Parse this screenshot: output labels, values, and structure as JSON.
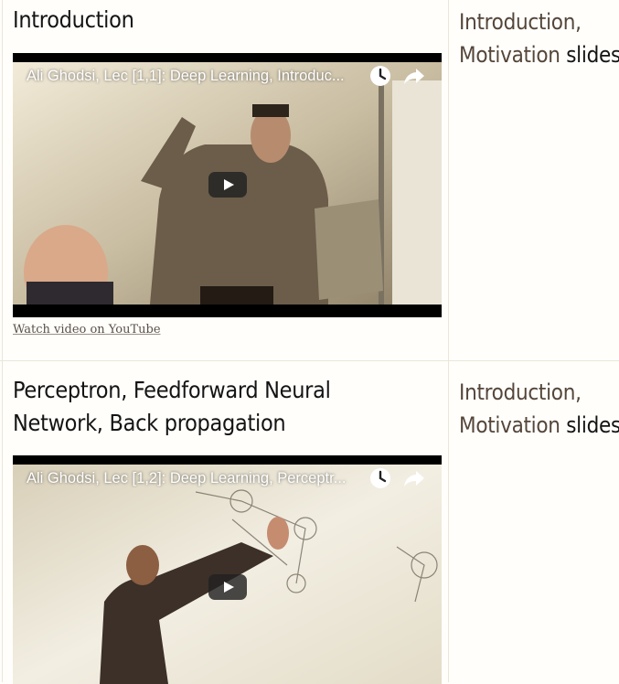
{
  "lectures": [
    {
      "title": "Introduction",
      "video_title": "Ali Ghodsi, Lec [1,1]: Deep Learning, Introduc...",
      "youtube_link": "Watch video on YouTube",
      "slides": {
        "link1": "Introduction,",
        "link2": "Motivation",
        "suffix": "slides"
      }
    },
    {
      "title": "Perceptron, Feedforward Neural Network, Back propagation",
      "video_title": "Ali Ghodsi, Lec [1,2]: Deep Learning, Perceptr...",
      "slides": {
        "link1": "Introduction,",
        "link2": "Motivation",
        "suffix": "slides"
      }
    }
  ],
  "icons": {
    "clock": "clock-icon",
    "share": "share-icon",
    "play": "play-icon"
  },
  "colors": {
    "slides_link": "#55463a",
    "background": "#fffefb"
  }
}
